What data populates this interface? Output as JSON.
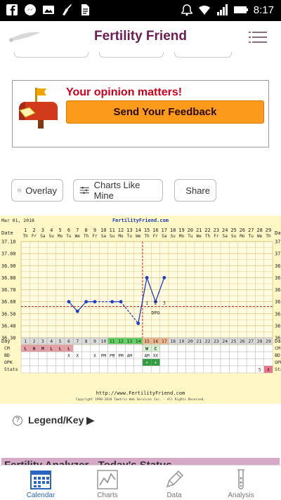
{
  "status_bar": {
    "time": "8:17"
  },
  "app": {
    "title": "Fertility Friend"
  },
  "feedback": {
    "heading": "Your opinion matters!",
    "button": "Send Your Feedback"
  },
  "actions": {
    "overlay": "Overlay",
    "charts_like_mine": "Charts Like Mine",
    "share": "Share"
  },
  "legend": {
    "label": "Legend/Key ▶"
  },
  "analyzer": {
    "label": "Fertility Analyzer - Today's Status"
  },
  "nav": {
    "calendar": "Calendar",
    "charts": "Charts",
    "data": "Data",
    "analysis": "Analysis"
  },
  "chart_data": {
    "type": "line",
    "title": "FertilityFriend.com",
    "start_label": "Mar 01, 2018",
    "footer_url": "http://www.FertilityFriend.com",
    "copyright": "Copyright 1998-2018 Tamtris Web Services Inc. - All Rights Reserved.",
    "date_header": "Date",
    "day_header": "Day",
    "dates": [
      "1",
      "2",
      "3",
      "4",
      "5",
      "6",
      "7",
      "8",
      "9",
      "10",
      "11",
      "12",
      "13",
      "14",
      "15",
      "16",
      "17",
      "18",
      "19",
      "20",
      "21",
      "22",
      "23",
      "24",
      "25",
      "26",
      "27",
      "28",
      "29"
    ],
    "weekdays": [
      "Th",
      "Fr",
      "Sa",
      "Su",
      "Mo",
      "Tu",
      "We",
      "Th",
      "Fr",
      "Sa",
      "Su",
      "Mo",
      "Tu",
      "We",
      "Th",
      "Fr",
      "Sa",
      "Su",
      "Mo",
      "Tu",
      "We",
      "Th",
      "Fr",
      "Sa",
      "Su",
      "Mo",
      "Tu",
      "We",
      "Th"
    ],
    "y_ticks": [
      "37.10",
      "37.00",
      "36.90",
      "36.80",
      "36.70",
      "36.60",
      "36.50",
      "36.40",
      "36.30"
    ],
    "ylim": [
      36.3,
      37.1
    ],
    "temps": [
      {
        "day": 6,
        "value": 36.6
      },
      {
        "day": 7,
        "value": 36.52
      },
      {
        "day": 8,
        "value": 36.6
      },
      {
        "day": 9,
        "value": 36.6
      },
      {
        "day": 11,
        "value": 36.6
      },
      {
        "day": 12,
        "value": 36.6
      },
      {
        "day": 14,
        "value": 36.42
      },
      {
        "day": 15,
        "value": 36.8
      },
      {
        "day": 16,
        "value": 36.6
      },
      {
        "day": 17,
        "value": 36.8
      }
    ],
    "coverline": 36.56,
    "ovulation_day": 14,
    "dpo_numbers": [
      "1",
      "2",
      "3"
    ],
    "dpo_label": "DPO",
    "row_labels": [
      "CM",
      "BD",
      "OPK",
      "Stats"
    ],
    "cm": [
      "L",
      "H",
      "M",
      "L",
      "L",
      "L",
      "",
      "",
      "",
      "",
      "",
      "",
      "",
      "",
      "W",
      "C",
      "",
      "",
      "",
      "",
      "",
      "",
      "",
      "",
      "",
      "",
      "",
      "",
      ""
    ],
    "bd": [
      "",
      "",
      "",
      "",
      "",
      "X",
      "X",
      "",
      "X",
      "PM",
      "PM",
      "PM",
      "AM",
      "",
      "AM",
      "XX",
      "",
      "",
      "",
      "",
      "",
      "",
      "",
      "",
      "",
      "",
      "",
      "",
      ""
    ],
    "opk": [
      "",
      "",
      "",
      "",
      "",
      "",
      "",
      "",
      "",
      "",
      "",
      "",
      "",
      "",
      "+",
      "+",
      "",
      "",
      "",
      "",
      "",
      "",
      "",
      "",
      "",
      "",
      "",
      "",
      ""
    ],
    "stats": [
      "",
      "",
      "",
      "",
      "",
      "",
      "",
      "",
      "",
      "",
      "",
      "",
      "",
      "",
      "",
      "",
      "",
      "",
      "",
      "",
      "",
      "",
      "",
      "",
      "",
      "",
      "",
      "5",
      "4"
    ],
    "colors": {
      "period": "#e8a0a8",
      "fertile": "#5fd35f",
      "dpo": "#f2b98e",
      "line": "#1f3fbf",
      "cover": "#c0281e"
    }
  }
}
